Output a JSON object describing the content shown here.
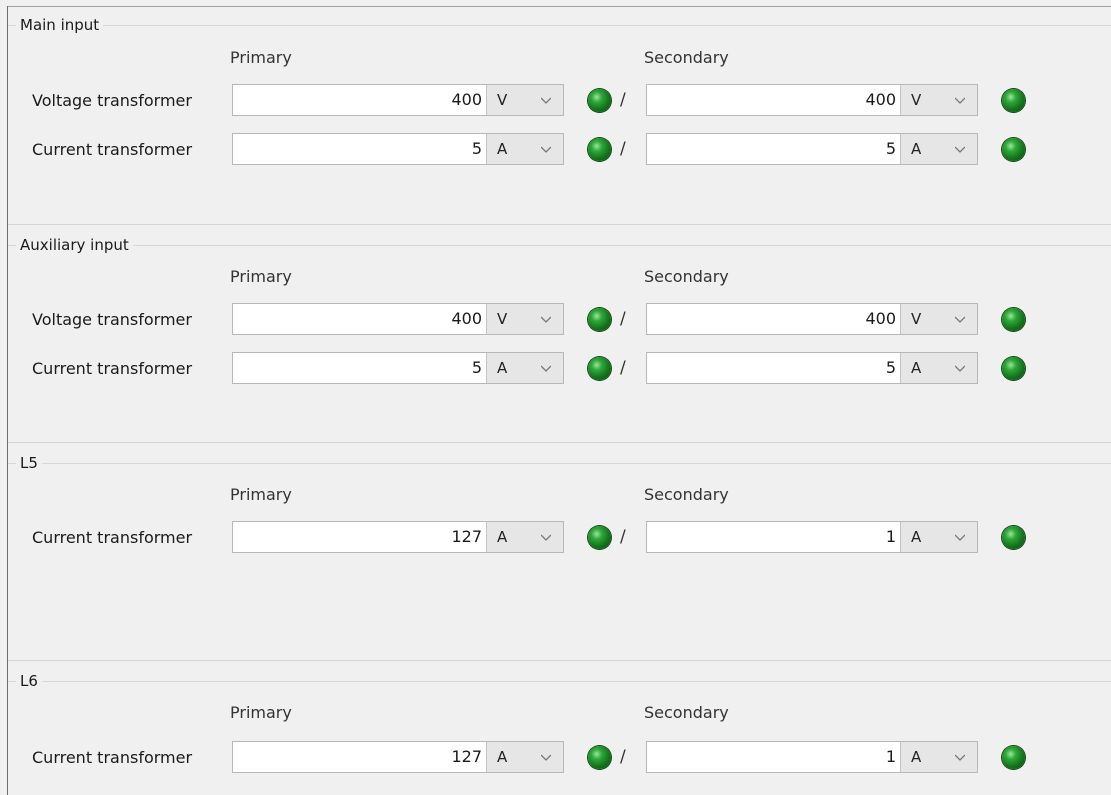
{
  "column_labels": {
    "primary": "Primary",
    "secondary": "Secondary"
  },
  "slash": "/",
  "groups": [
    {
      "title": "Main input",
      "rows": [
        {
          "label": "Voltage transformer",
          "primary_value": "400",
          "primary_unit": "V",
          "secondary_value": "400",
          "secondary_unit": "V"
        },
        {
          "label": "Current transformer",
          "primary_value": "5",
          "primary_unit": "A",
          "secondary_value": "5",
          "secondary_unit": "A"
        }
      ]
    },
    {
      "title": "Auxiliary input",
      "rows": [
        {
          "label": "Voltage transformer",
          "primary_value": "400",
          "primary_unit": "V",
          "secondary_value": "400",
          "secondary_unit": "V"
        },
        {
          "label": "Current transformer",
          "primary_value": "5",
          "primary_unit": "A",
          "secondary_value": "5",
          "secondary_unit": "A"
        }
      ]
    },
    {
      "title": "L5",
      "rows": [
        {
          "label": "Current transformer",
          "primary_value": "127",
          "primary_unit": "A",
          "secondary_value": "1",
          "secondary_unit": "A"
        }
      ]
    },
    {
      "title": "L6",
      "rows": [
        {
          "label": "Current transformer",
          "primary_value": "127",
          "primary_unit": "A",
          "secondary_value": "1",
          "secondary_unit": "A"
        }
      ]
    }
  ],
  "status_led_color": "#1f8a2a"
}
